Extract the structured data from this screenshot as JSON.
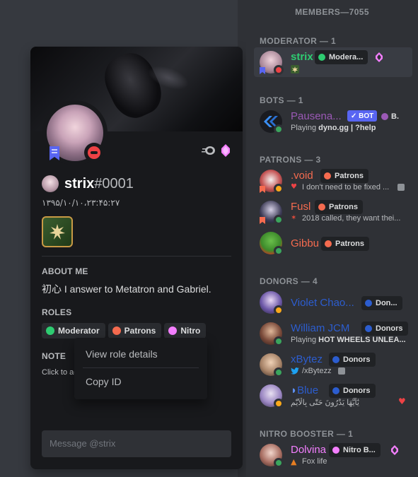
{
  "profile": {
    "username": "strix",
    "discriminator": "#0001",
    "date_text": "۱۳۹۵/۱۰/۱۰،۲۳:۴۵:۲۷",
    "about_title": "ABOUT ME",
    "about_text": "初心 I answer to Metatron and Gabriel.",
    "roles_title": "ROLES",
    "roles": [
      {
        "label": "Moderator",
        "color": "#2ecc71"
      },
      {
        "label": "Patrons",
        "color": "#f56b4f"
      },
      {
        "label": "Nitro",
        "color": "#f47fff"
      }
    ],
    "note_title": "NOTE",
    "note_placeholder": "Click to add a note",
    "message_placeholder": "Message @strix"
  },
  "context_menu": {
    "items": [
      "View role details",
      "Copy ID"
    ]
  },
  "members": {
    "header": "MEMBERS—7055",
    "groups": {
      "moderator": "MODERATOR — 1",
      "bots": "BOTS — 1",
      "patrons": "PATRONS — 3",
      "donors": "DONORS — 4",
      "nitro": "NITRO BOOSTER — 1"
    },
    "list": [
      {
        "name": "strix",
        "color": "#2ecc71",
        "role": "Modera...",
        "role_color": "#2ecc71",
        "sub": ""
      },
      {
        "name": "Pausena...",
        "color": "#9b59b6",
        "bot": "✓ BOT",
        "role": "B.",
        "role_color": "#9b59b6",
        "sub_prefix": "Playing ",
        "sub_bold": "dyno.gg | ?help"
      },
      {
        "name": ".void",
        "color": "#f56b4f",
        "role": "Patrons",
        "role_color": "#f56b4f",
        "sub": "I don't need to be fixed ..."
      },
      {
        "name": "Fusl",
        "color": "#f56b4f",
        "role": "Patrons",
        "role_color": "#f56b4f",
        "sub": "2018 called, they want thei..."
      },
      {
        "name": "Gibbu",
        "color": "#f56b4f",
        "role": "Patrons",
        "role_color": "#f56b4f",
        "sub": ""
      },
      {
        "name": "Violet Chao...",
        "color": "#2c5dcf",
        "role": "Don...",
        "role_color": "#2c5dcf",
        "sub": ""
      },
      {
        "name": "William JCM",
        "color": "#2c5dcf",
        "role": "Donors",
        "role_color": "#2c5dcf",
        "sub_prefix": "Playing ",
        "sub_bold": "HOT WHEELS UNLEA..."
      },
      {
        "name": "xBytez",
        "color": "#2c5dcf",
        "role": "Donors",
        "role_color": "#2c5dcf",
        "sub": "/xBytezz"
      },
      {
        "name": "Blue",
        "color": "#2c5dcf",
        "role": "Donors",
        "role_color": "#2c5dcf",
        "sub": "يٰٓاَيُّهَا يَدْرُونَ حَتّٰى بِالْاَيّٰمِ"
      },
      {
        "name": "Dolvina",
        "color": "#f47fff",
        "role": "Nitro B...",
        "role_color": "#f47fff",
        "sub": "Fox life"
      }
    ]
  }
}
